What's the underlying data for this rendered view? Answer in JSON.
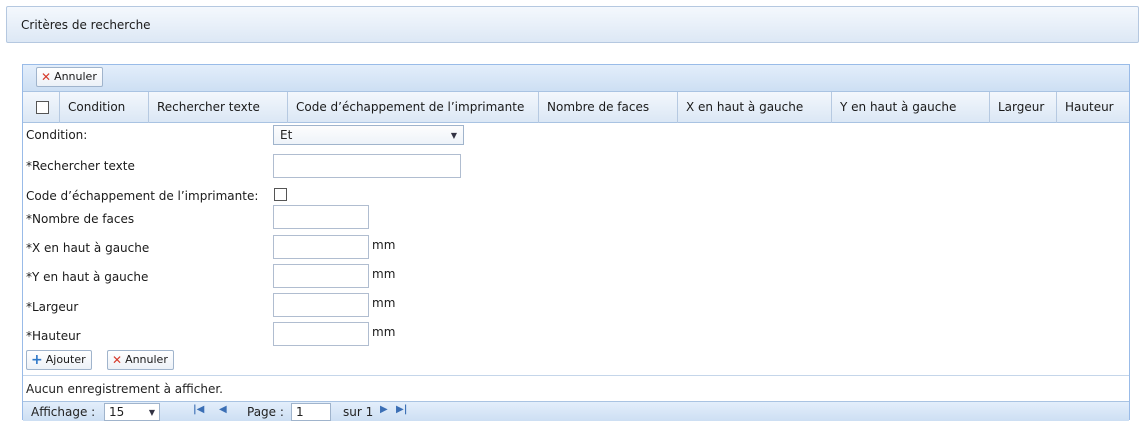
{
  "panel": {
    "title": "Critères de recherche"
  },
  "toolbar": {
    "cancel_label": "Annuler"
  },
  "columns": [
    "Condition",
    "Rechercher texte",
    "Code d’échappement de l’imprimante",
    "Nombre de faces",
    "X en haut à gauche",
    "Y en haut à gauche",
    "Largeur",
    "Hauteur"
  ],
  "form": {
    "condition_label": "Condition:",
    "condition_value": "Et",
    "search_text_label": "*Rechercher texte",
    "search_text_value": "",
    "escape_code_label": "Code d’échappement de l’imprimante:",
    "faces_label": "*Nombre de faces",
    "faces_value": "",
    "x_label": "*X en haut à gauche",
    "x_value": "",
    "y_label": "*Y en haut à gauche",
    "y_value": "",
    "width_label": "*Largeur",
    "width_value": "",
    "height_label": "*Hauteur",
    "height_value": "",
    "unit": "mm",
    "add_label": "Ajouter",
    "cancel_label": "Annuler"
  },
  "empty_message": "Aucun enregistrement à afficher.",
  "pager": {
    "display_label": "Affichage :",
    "page_size": "15",
    "page_label": "Page :",
    "page_value": "1",
    "of_label": "sur 1"
  },
  "icons": {
    "cancel": "x-icon",
    "add": "plus-icon",
    "first": "first-page-icon",
    "prev": "prev-page-icon",
    "next": "next-page-icon",
    "last": "last-page-icon"
  },
  "colors": {
    "header_gradient_top": "#e3eefb",
    "header_gradient_bottom": "#cddff3",
    "border": "#99bbe8",
    "cancel_icon": "#d63a2b",
    "add_icon": "#2f78c8"
  }
}
